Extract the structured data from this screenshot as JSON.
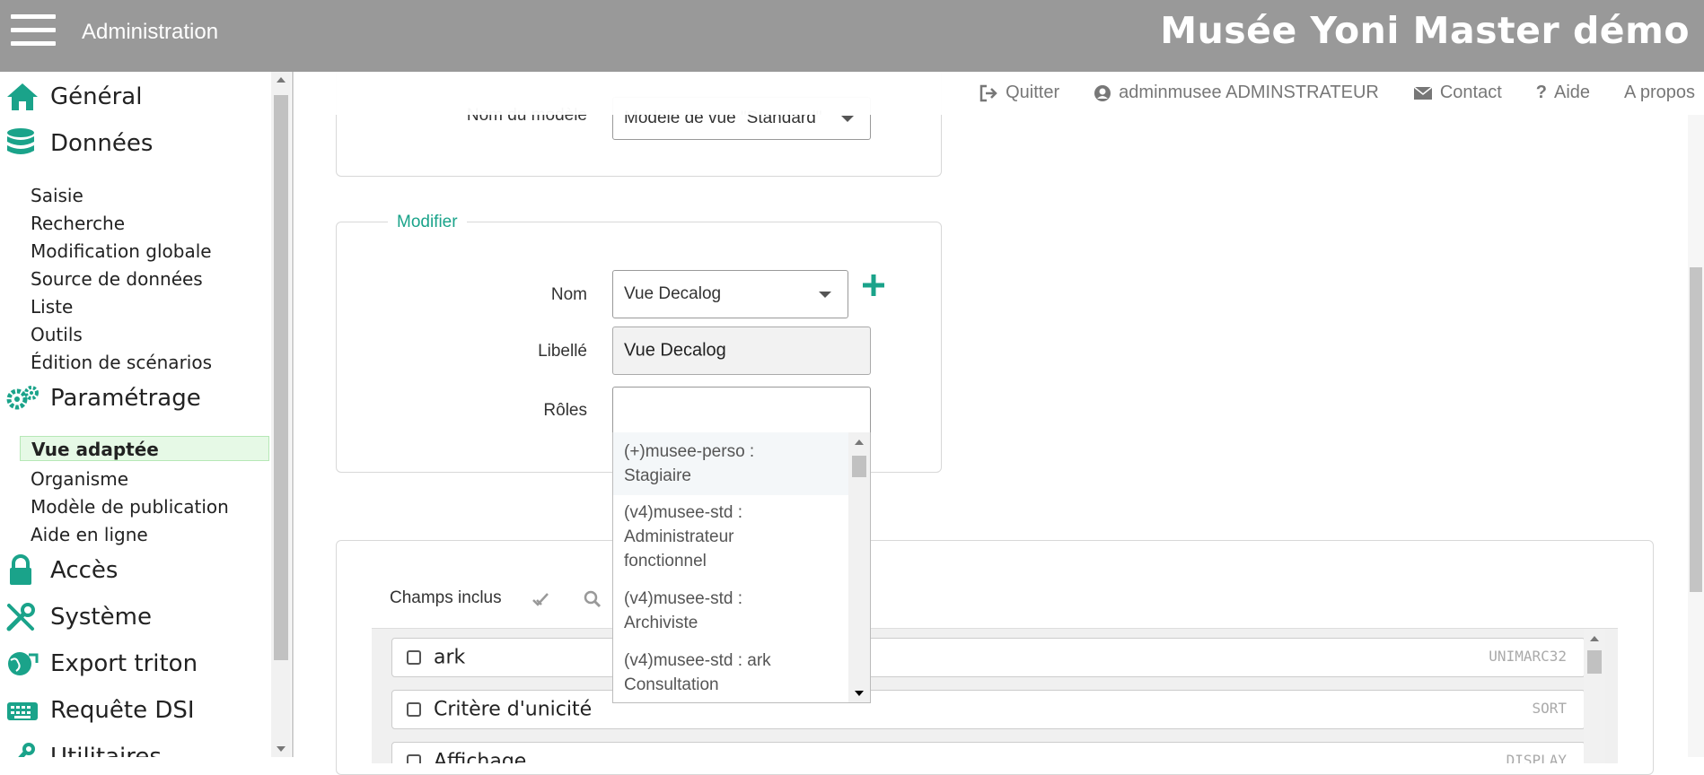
{
  "header": {
    "menu_icon": "hamburger-icon",
    "section_title": "Administration",
    "app_title": "Musée Yoni Master démo",
    "bg_color": "#999999"
  },
  "sidebar": {
    "sections": [
      {
        "label": "Général",
        "icon": "home-icon"
      },
      {
        "label": "Données",
        "icon": "database-icon"
      },
      {
        "label": "Paramétrage",
        "icon": "gears-icon"
      },
      {
        "label": "Accès",
        "icon": "lock-icon"
      },
      {
        "label": "Système",
        "icon": "wrench-icon"
      },
      {
        "label": "Export triton",
        "icon": "globe-export-icon"
      },
      {
        "label": "Requête DSI",
        "icon": "keyboard-icon"
      },
      {
        "label": "Utilitaires",
        "icon": "tools-icon"
      }
    ],
    "donnees_items": [
      "Saisie",
      "Recherche",
      "Modification globale",
      "Source de données",
      "Liste",
      "Outils",
      "Édition de scénarios"
    ],
    "parametrage_items": [
      "Vue adaptée",
      "Organisme",
      "Modèle de publication",
      "Aide en ligne"
    ],
    "active_item": "Vue adaptée",
    "accent_color": "#1aa38a"
  },
  "toplinks": {
    "quit": "Quitter",
    "user": "adminmusee ADMINSTRATEUR",
    "contact": "Contact",
    "help": "Aide",
    "about": "A propos"
  },
  "model_panel": {
    "label": "Nom du modèle",
    "value": "Modèle de vue \"Standard\""
  },
  "modify_panel": {
    "legend": "Modifier",
    "nom_label": "Nom",
    "nom_value": "Vue Decalog",
    "libelle_label": "Libellé",
    "libelle_value": "Vue Decalog",
    "roles_label": "Rôles",
    "roles_value": "",
    "roles_options": [
      {
        "line1": "(+)musee-perso :",
        "line2": "Stagiaire",
        "line3": ""
      },
      {
        "line1": "(v4)musee-std :",
        "line2": "Administrateur",
        "line3": "fonctionnel"
      },
      {
        "line1": "(v4)musee-std :",
        "line2": "Archiviste",
        "line3": ""
      },
      {
        "line1": "(v4)musee-std : ark",
        "line2": "Consultation",
        "line3": ""
      }
    ]
  },
  "fields_panel": {
    "label": "Champs inclus",
    "fields": [
      {
        "name": "ark",
        "code": "UNIMARC32"
      },
      {
        "name": "Critère d'unicité",
        "code": "SORT"
      },
      {
        "name": "Affichage",
        "code": "DISPLAY"
      }
    ]
  }
}
